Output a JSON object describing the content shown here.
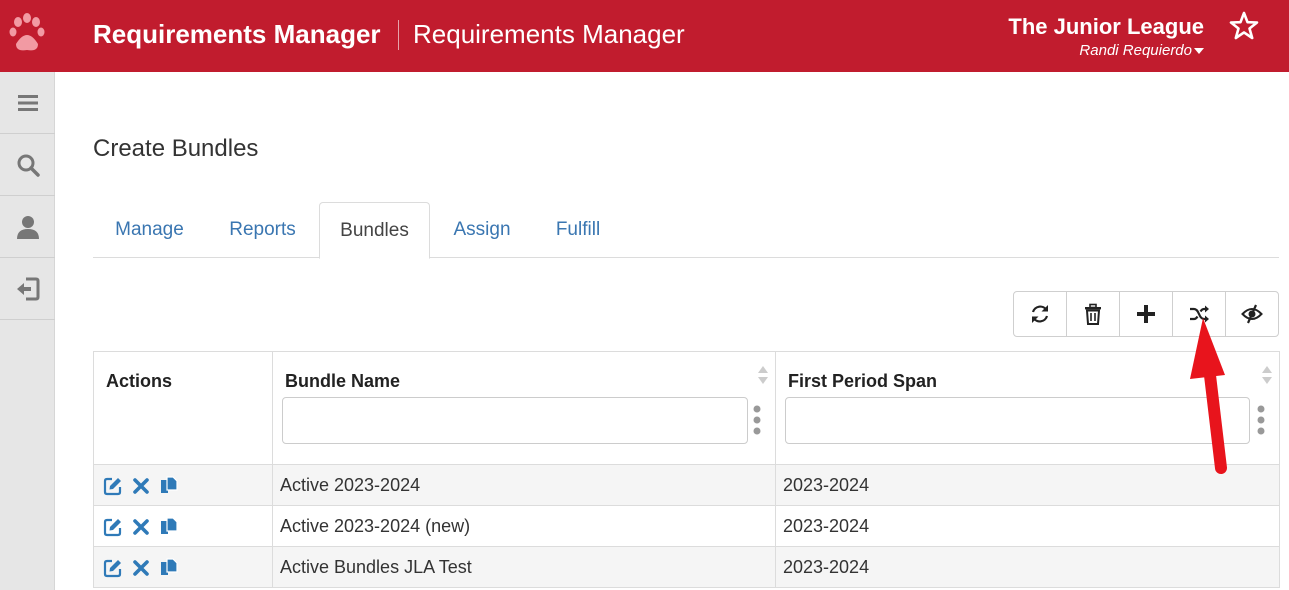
{
  "header": {
    "app_title": "Requirements Manager",
    "module_title": "Requirements Manager",
    "org_name": "The Junior League",
    "user_name": "Randi Requierdo"
  },
  "sidebar": {
    "items": [
      {
        "icon": "hamburger-menu-icon"
      },
      {
        "icon": "search-icon"
      },
      {
        "icon": "user-icon"
      },
      {
        "icon": "logout-icon"
      }
    ]
  },
  "page": {
    "title": "Create Bundles"
  },
  "tabs": [
    {
      "label": "Manage"
    },
    {
      "label": "Reports"
    },
    {
      "label": "Bundles",
      "active": true
    },
    {
      "label": "Assign"
    },
    {
      "label": "Fulfill"
    }
  ],
  "toolbar": {
    "buttons": [
      "refresh-icon",
      "trash-icon",
      "plus-icon",
      "shuffle-icon",
      "eye-slash-icon"
    ]
  },
  "table": {
    "columns": [
      "Actions",
      "Bundle Name",
      "First Period Span"
    ],
    "filters": {
      "bundle_name": "",
      "first_period_span": ""
    },
    "rows": [
      {
        "bundle_name": "Active 2023-2024",
        "first_period_span": "2023-2024"
      },
      {
        "bundle_name": "Active 2023-2024 (new)",
        "first_period_span": "2023-2024"
      },
      {
        "bundle_name": "Active Bundles JLA Test",
        "first_period_span": "2023-2024"
      }
    ]
  },
  "colors": {
    "brand_red": "#c11c2e",
    "link_blue": "#3a76b1",
    "action_blue": "#2f7ab8",
    "annotation_red": "#e8141c"
  }
}
